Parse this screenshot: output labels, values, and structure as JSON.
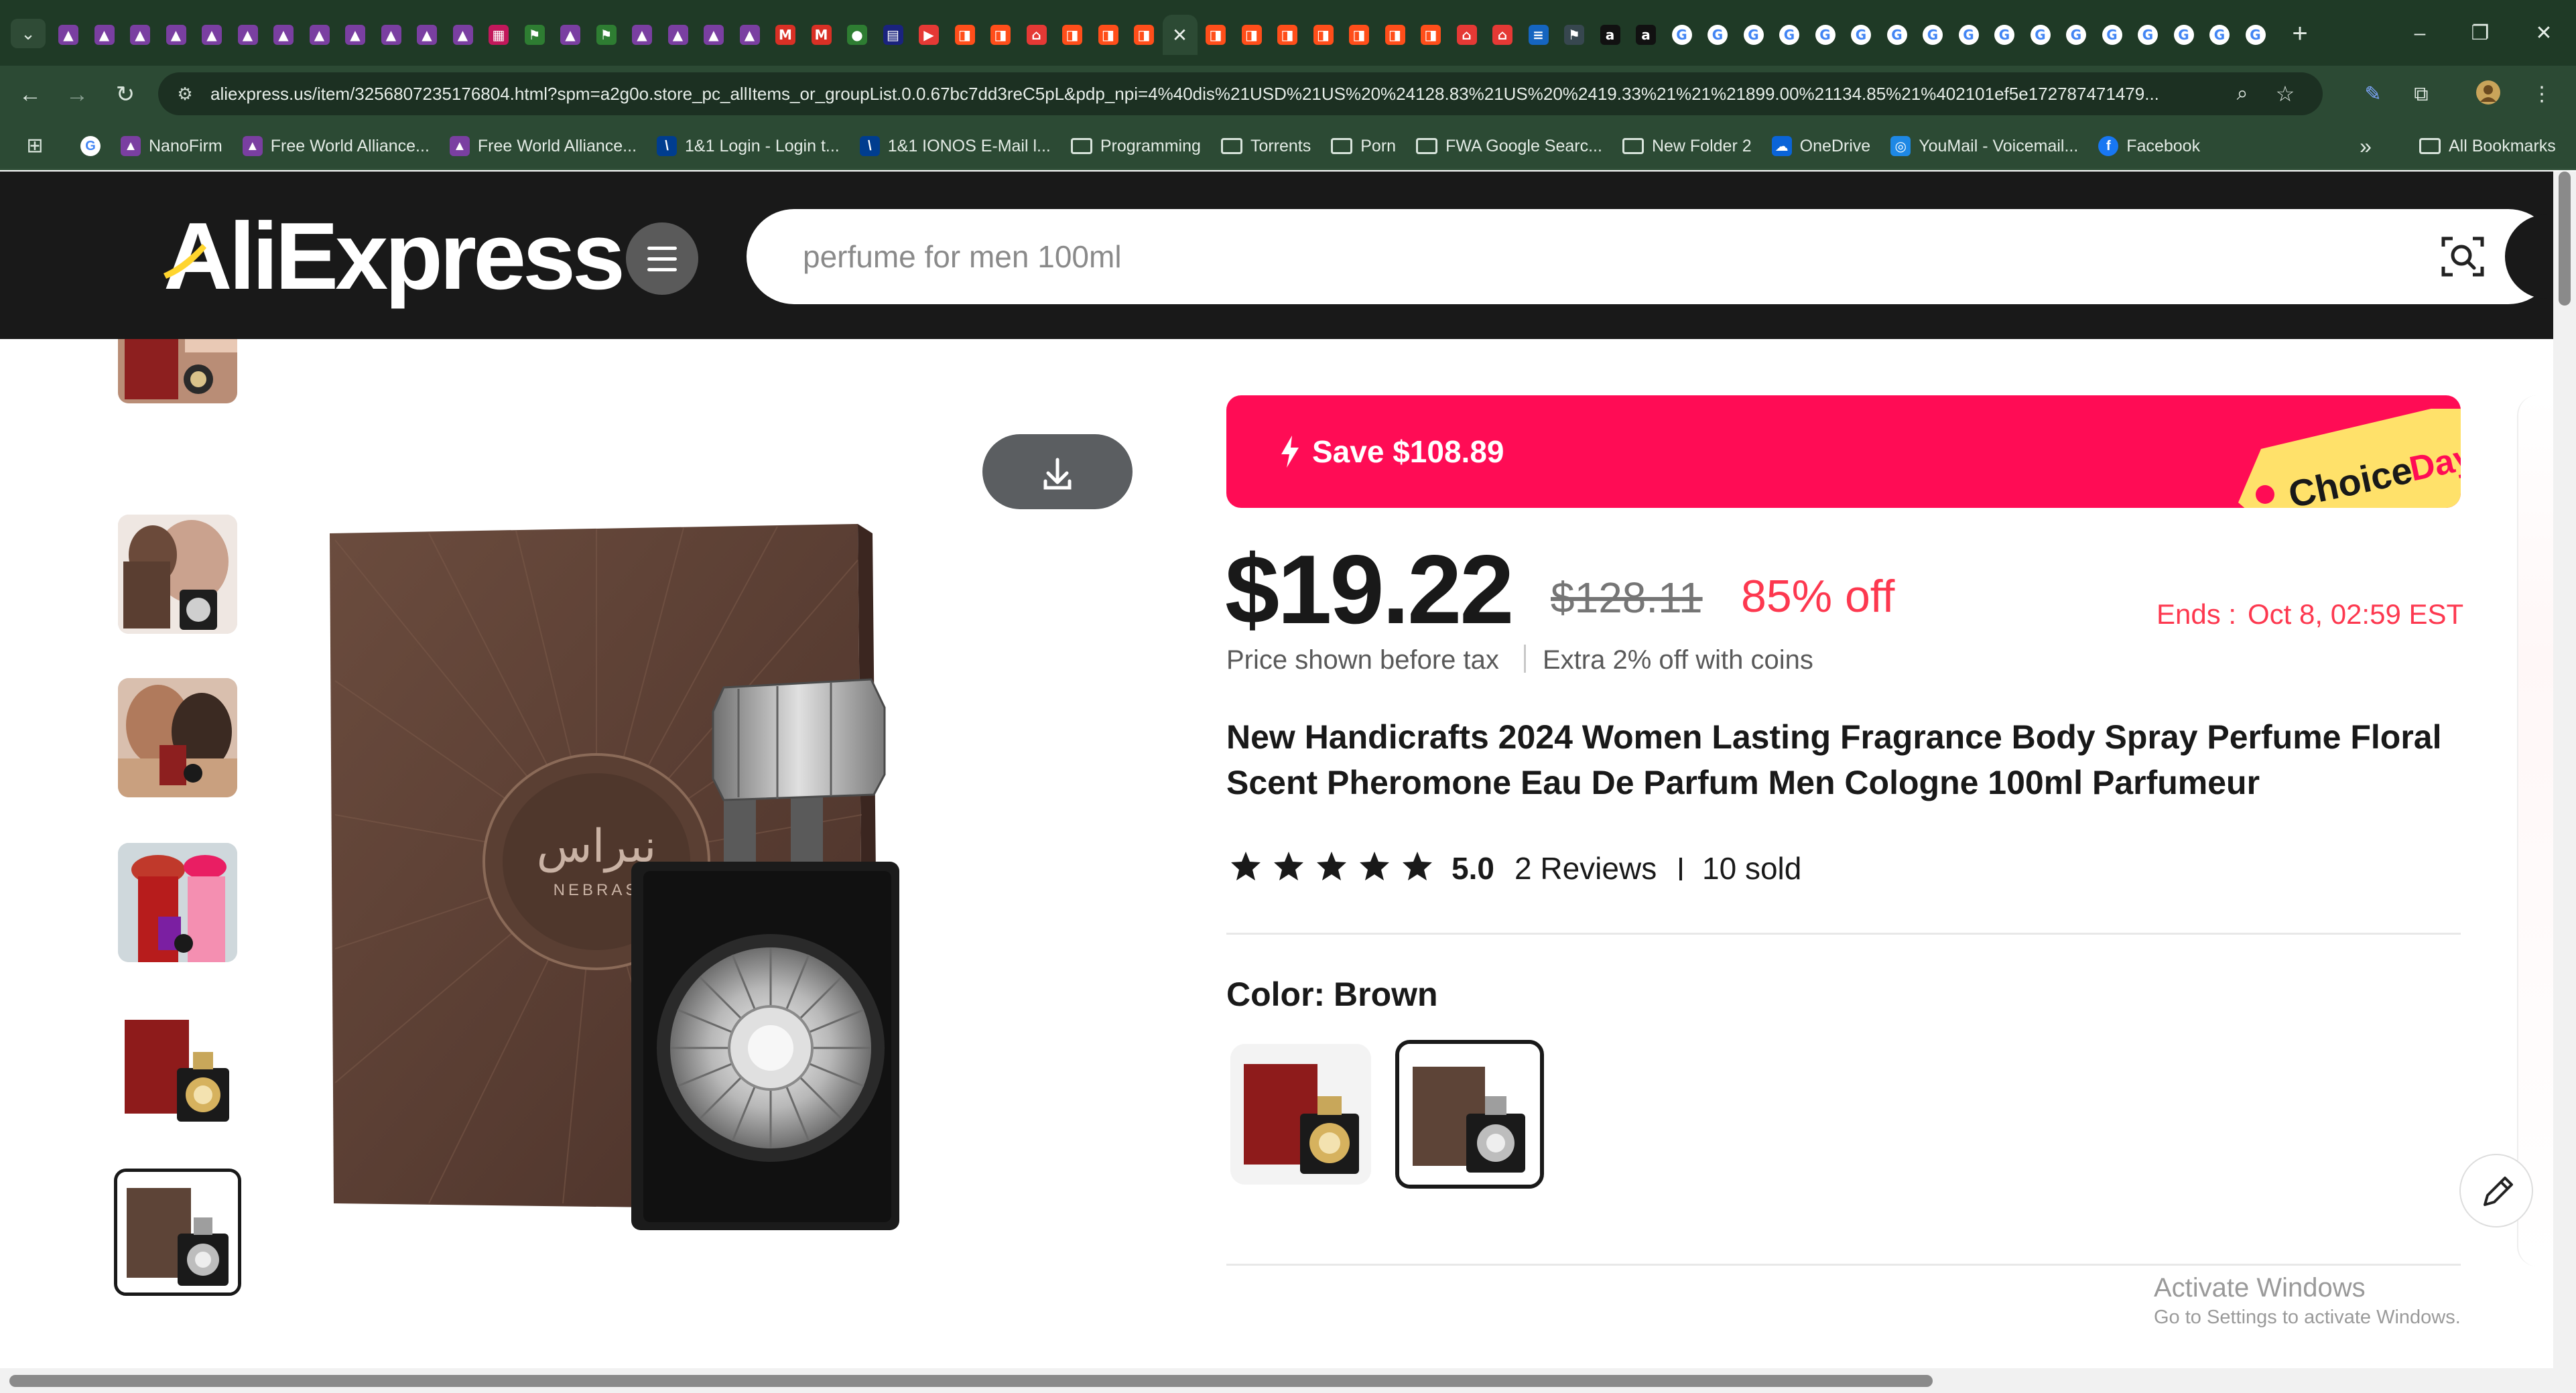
{
  "browser": {
    "tabs": [
      {
        "icon": "triangle-favicon",
        "color": "#7a3fa1"
      },
      {
        "icon": "triangle-favicon",
        "color": "#7a3fa1"
      },
      {
        "icon": "triangle-favicon",
        "color": "#7a3fa1"
      },
      {
        "icon": "triangle-favicon",
        "color": "#7a3fa1"
      },
      {
        "icon": "triangle-favicon",
        "color": "#7a3fa1"
      },
      {
        "icon": "triangle-favicon",
        "color": "#7a3fa1"
      },
      {
        "icon": "triangle-favicon",
        "color": "#7a3fa1"
      },
      {
        "icon": "triangle-favicon",
        "color": "#7a3fa1"
      },
      {
        "icon": "triangle-favicon",
        "color": "#7a3fa1"
      },
      {
        "icon": "triangle-favicon",
        "color": "#7a3fa1"
      },
      {
        "icon": "triangle-favicon",
        "color": "#7a3fa1"
      },
      {
        "icon": "triangle-favicon",
        "color": "#7a3fa1"
      },
      {
        "icon": "grid-favicon",
        "color": "#c2185b"
      },
      {
        "icon": "flag-favicon",
        "color": "#2e7d32"
      },
      {
        "icon": "triangle-favicon",
        "color": "#7a3fa1"
      },
      {
        "icon": "flag-favicon",
        "color": "#2e7d32"
      },
      {
        "icon": "triangle-favicon",
        "color": "#7a3fa1"
      },
      {
        "icon": "triangle-favicon",
        "color": "#7a3fa1"
      },
      {
        "icon": "triangle-favicon",
        "color": "#7a3fa1"
      },
      {
        "icon": "triangle-favicon",
        "color": "#7a3fa1"
      },
      {
        "icon": "gmail-favicon",
        "color": "#d93025"
      },
      {
        "icon": "gmail-favicon",
        "color": "#d93025"
      },
      {
        "icon": "apple-favicon",
        "color": "#2e7d32"
      },
      {
        "icon": "doc-favicon",
        "color": "#1a237e"
      },
      {
        "icon": "play-favicon",
        "color": "#e53935"
      },
      {
        "icon": "aliexpress-favicon",
        "color": "#ff4e1a"
      },
      {
        "icon": "aliexpress-favicon",
        "color": "#ff4e1a"
      },
      {
        "icon": "store-favicon",
        "color": "#e53935"
      },
      {
        "icon": "aliexpress-favicon",
        "color": "#ff4e1a"
      },
      {
        "icon": "aliexpress-favicon",
        "color": "#ff4e1a"
      },
      {
        "icon": "aliexpress-favicon",
        "color": "#ff4e1a"
      },
      {
        "icon": "close-icon",
        "color": "#2c4a34",
        "active": true
      },
      {
        "icon": "aliexpress-favicon",
        "color": "#ff4e1a"
      },
      {
        "icon": "aliexpress-favicon",
        "color": "#ff4e1a"
      },
      {
        "icon": "aliexpress-favicon",
        "color": "#ff4e1a"
      },
      {
        "icon": "aliexpress-favicon",
        "color": "#ff4e1a"
      },
      {
        "icon": "aliexpress-favicon",
        "color": "#ff4e1a"
      },
      {
        "icon": "aliexpress-favicon",
        "color": "#ff4e1a"
      },
      {
        "icon": "aliexpress-favicon",
        "color": "#ff4e1a"
      },
      {
        "icon": "store-favicon",
        "color": "#e53935"
      },
      {
        "icon": "store-favicon",
        "color": "#e53935"
      },
      {
        "icon": "news-favicon",
        "color": "#1565c0"
      },
      {
        "icon": "flag-favicon",
        "color": "#37474f"
      },
      {
        "icon": "amazon-favicon",
        "color": "#111111"
      },
      {
        "icon": "amazon-favicon",
        "color": "#111111"
      },
      {
        "icon": "google-favicon",
        "color": "#ffffff"
      },
      {
        "icon": "google-favicon",
        "color": "#ffffff"
      },
      {
        "icon": "google-favicon",
        "color": "#ffffff"
      },
      {
        "icon": "google-favicon",
        "color": "#ffffff"
      },
      {
        "icon": "google-favicon",
        "color": "#ffffff"
      },
      {
        "icon": "google-favicon",
        "color": "#ffffff"
      },
      {
        "icon": "google-favicon",
        "color": "#ffffff"
      },
      {
        "icon": "google-favicon",
        "color": "#ffffff"
      },
      {
        "icon": "google-favicon",
        "color": "#ffffff"
      },
      {
        "icon": "google-favicon",
        "color": "#ffffff"
      },
      {
        "icon": "google-favicon",
        "color": "#ffffff"
      },
      {
        "icon": "google-favicon",
        "color": "#ffffff"
      },
      {
        "icon": "google-favicon",
        "color": "#ffffff"
      },
      {
        "icon": "google-favicon",
        "color": "#ffffff"
      },
      {
        "icon": "google-favicon",
        "color": "#ffffff"
      },
      {
        "icon": "google-favicon",
        "color": "#ffffff"
      },
      {
        "icon": "google-favicon",
        "color": "#ffffff"
      }
    ],
    "url": "aliexpress.us/item/3256807235176804.html?spm=a2g0o.store_pc_allItems_or_groupList.0.0.67bc7dd3reC5pL&pdp_npi=4%40dis%21USD%21US%20%24128.83%21US%20%2419.33%21%21%21899.00%21134.85%21%402101ef5e172787471479...",
    "bookmarks": [
      {
        "label": "",
        "icon": "google-icon"
      },
      {
        "label": "NanoFirm",
        "icon": "triangle-icon"
      },
      {
        "label": "Free World Alliance...",
        "icon": "triangle-icon"
      },
      {
        "label": "Free World Alliance...",
        "icon": "triangle-icon"
      },
      {
        "label": "1&1 Login - Login t...",
        "icon": "ionos-icon"
      },
      {
        "label": "1&1 IONOS E-Mail l...",
        "icon": "ionos-icon"
      },
      {
        "label": "Programming",
        "icon": "folder-icon"
      },
      {
        "label": "Torrents",
        "icon": "folder-icon"
      },
      {
        "label": "Porn",
        "icon": "folder-icon"
      },
      {
        "label": "FWA Google Searc...",
        "icon": "folder-icon"
      },
      {
        "label": "New Folder 2",
        "icon": "folder-icon"
      },
      {
        "label": "OneDrive",
        "icon": "cloud-icon"
      },
      {
        "label": "YouMail - Voicemail...",
        "icon": "youmail-icon"
      },
      {
        "label": "Facebook",
        "icon": "facebook-icon"
      }
    ],
    "all_bookmarks": "All Bookmarks"
  },
  "header": {
    "logo": "AliExpress",
    "search_placeholder": "perfume for men 100ml"
  },
  "product": {
    "promo_save": "Save $108.89",
    "promo_badge": "Choice",
    "promo_badge_day": "Day",
    "price": "$19.22",
    "original_price": "$128.11",
    "discount": "85% off",
    "ends_label": "Ends :",
    "ends_date": "Oct 8, 02:59 EST",
    "tax_note": "Price shown before tax",
    "coin_note": "Extra 2% off with coins",
    "title": "New Handicrafts 2024 Women Lasting Fragrance Body Spray Perfume Floral Scent Pheromone Eau De Parfum Men Cologne 100ml Parfumeur",
    "rating": "5.0",
    "stars": 5,
    "reviews": "2 Reviews",
    "sold": "10 sold",
    "color_label": "Color:",
    "color_value": "Brown",
    "box_arabic": "نبراس",
    "box_latin": "NEBRAS"
  },
  "os": {
    "activate_title": "Activate Windows",
    "activate_sub": "Go to Settings to activate Windows."
  },
  "colors": {
    "brand_red": "#ff0c55",
    "discount_red": "#fd384f",
    "choice_yellow": "#ffe16a",
    "header_bg": "#191919",
    "browser_green": "#2c4a34"
  }
}
